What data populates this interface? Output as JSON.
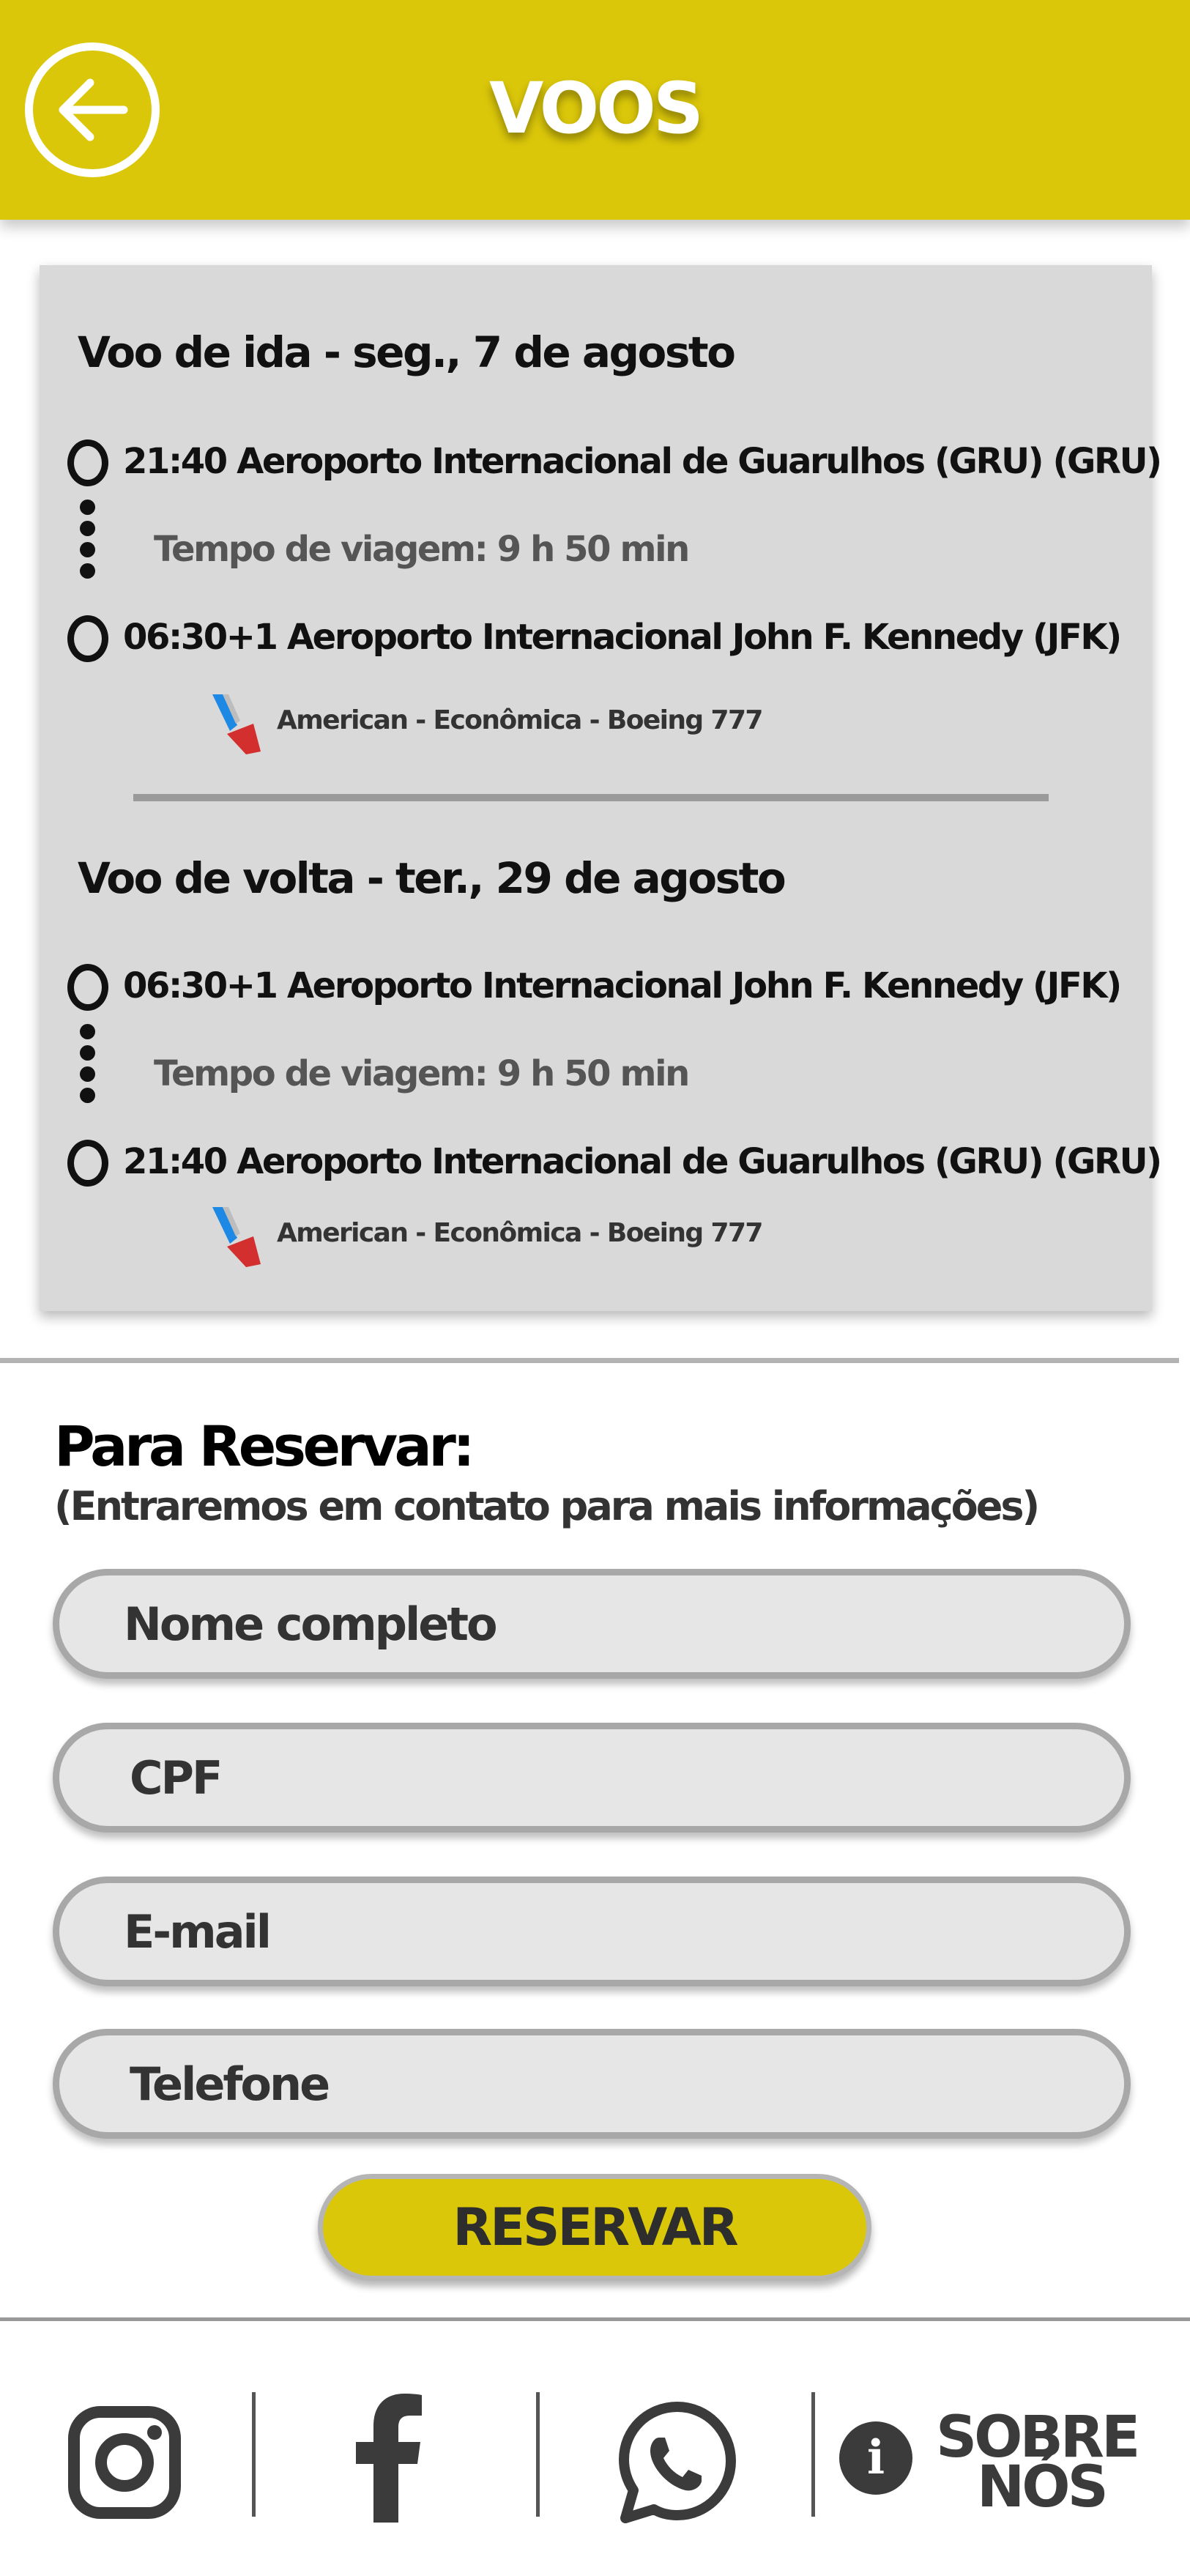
{
  "header": {
    "title": "VOOS",
    "back_icon": "arrow-left-icon",
    "color": "#dbc70a"
  },
  "outbound": {
    "title": "Voo de ida - seg., 7 de agosto",
    "departure": "21:40 Aeroporto Internacional de Guarulhos (GRU) (GRU)",
    "duration": "Tempo de viagem: 9 h 50 min",
    "arrival": "06:30+1 Aeroporto Internacional John F. Kennedy (JFK)",
    "airline": "American - Econômica - Boeing 777"
  },
  "return": {
    "title": "Voo de volta - ter., 29 de agosto",
    "departure": "06:30+1 Aeroporto Internacional John F. Kennedy (JFK)",
    "duration": "Tempo de viagem: 9 h 50 min",
    "arrival": "21:40 Aeroporto Internacional de Guarulhos (GRU) (GRU)",
    "airline": "American - Econômica - Boeing 777"
  },
  "booking": {
    "title": "Para Reservar:",
    "subtitle": "(Entraremos em contato para mais informações)",
    "fields": {
      "name_placeholder": "Nome completo",
      "cpf_placeholder": "CPF",
      "email_placeholder": "E-mail",
      "phone_placeholder": "Telefone"
    },
    "submit_label": "RESERVAR"
  },
  "footer": {
    "icons": [
      "instagram-icon",
      "facebook-icon",
      "whatsapp-icon",
      "info-icon"
    ],
    "about_line1": "SOBRE",
    "about_line2": "NÓS",
    "info_glyph": "i"
  }
}
